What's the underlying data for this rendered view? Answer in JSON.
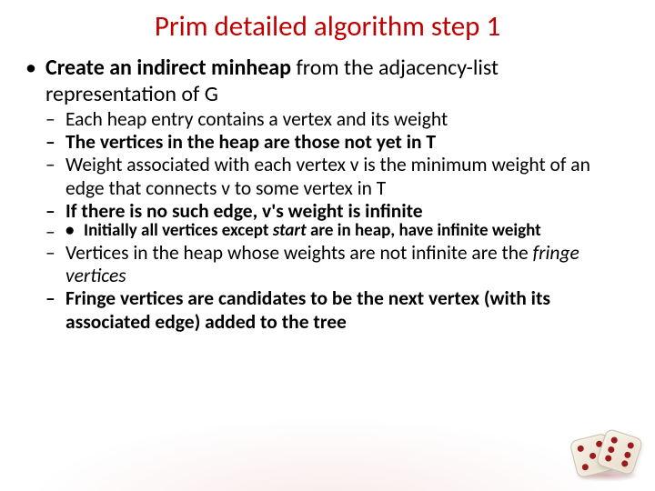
{
  "title": "Prim detailed algorithm step 1",
  "bullets": {
    "l1_prefix_bold": "Create an indirect minheap",
    "l1_rest": " from the adjacency-list representation of G",
    "l2": [
      "Each heap entry contains a vertex and its weight",
      "The vertices in the heap are those not yet in T",
      "Weight associated with each vertex v is the minimum weight of an edge that connects v to some vertex in T",
      "If there is no such edge, v's weight is infinite"
    ],
    "l3_prefix": "Initially all vertices except ",
    "l3_italic": "start",
    "l3_rest": " are in heap, have infinite weight",
    "l2b_prefix": "Vertices in the heap whose weights are not infinite are the ",
    "l2b_italic": "fringe vertices",
    "l2c": "Fringe vertices are candidates to be the next vertex (with its associated edge) added to the tree"
  }
}
